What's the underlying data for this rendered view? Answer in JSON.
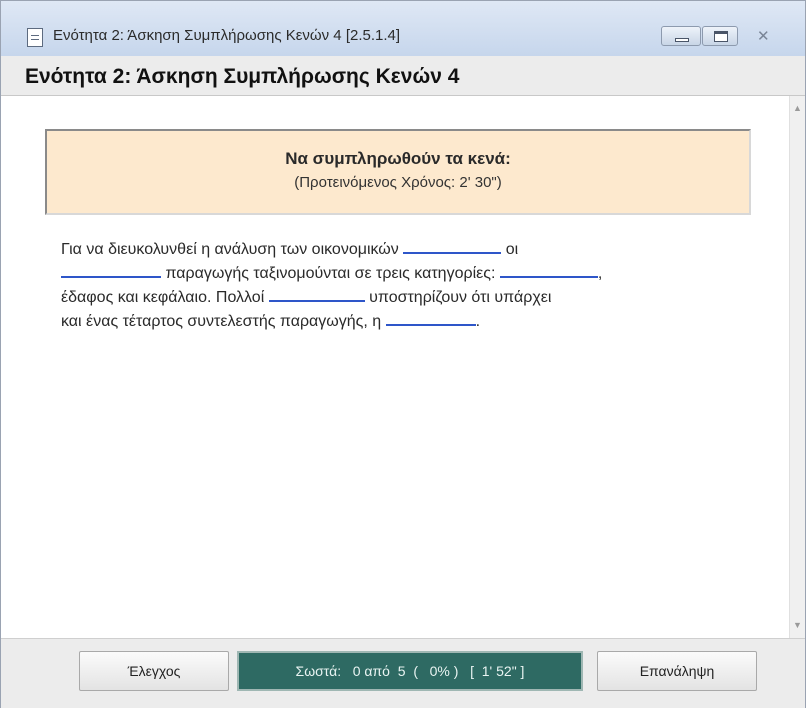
{
  "window": {
    "title": "Ενότητα 2: Άσκηση Συμπλήρωσης Κενών 4   [2.5.1.4]",
    "icon": "document-icon",
    "controls": [
      "minimize-icon",
      "maximize-icon",
      "close-icon"
    ]
  },
  "header": {
    "title": "Ενότητα 2: Άσκηση Συμπλήρωσης Κενών 4"
  },
  "instruction": {
    "title": "Να συμπληρωθούν τα κενά:",
    "subtitle": "(Προτεινόμενος Χρόνος: 2' 30\")"
  },
  "exercise": {
    "line1_a": "Για να διευκολυνθεί η ανάλυση των οικονομικών ",
    "line1_b": " οι",
    "line2_a": " παραγωγής ταξινομούνται σε τρεις κατηγορίες: ",
    "line2_b": ",",
    "line3_a": "έδαφος και κεφάλαιο. Πολλοί ",
    "line3_b": " υποστηρίζουν ότι υπάρχει",
    "line4_a": "και ένας τέταρτος συντελεστής παραγωγής, η ",
    "line4_b": ".",
    "blanks": [
      "",
      "",
      "",
      "",
      ""
    ]
  },
  "footer": {
    "check_label": "Έλεγχος",
    "status_text": "Σωστά:   0 από  5  (   0% )   [  1' 52\" ]",
    "repeat_label": "Επανάληψη"
  },
  "colors": {
    "instruction_bg": "#fde9ce",
    "status_bg": "#2e6a63",
    "blank_underline": "#2e56c9"
  }
}
